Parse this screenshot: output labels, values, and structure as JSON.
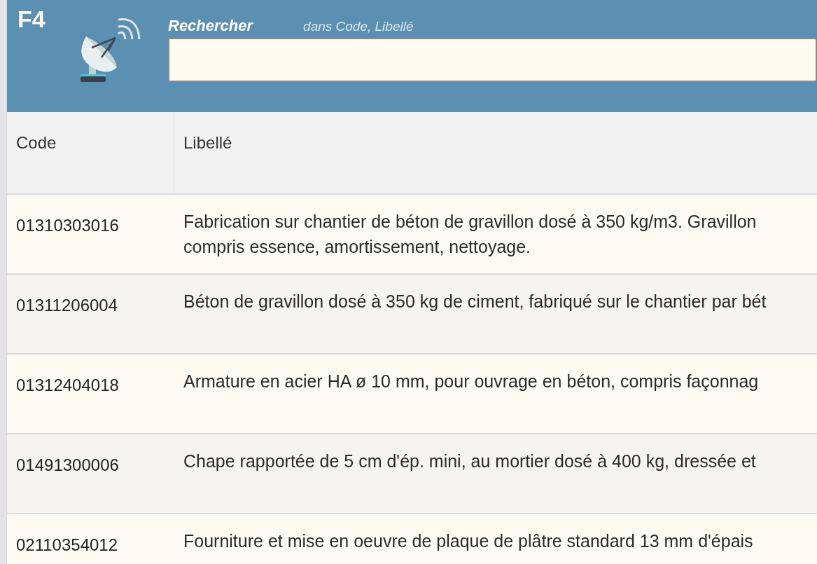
{
  "header": {
    "shortcut": "F4",
    "search_label": "Rechercher",
    "search_scope": "dans Code, Libellé"
  },
  "table": {
    "columns": [
      "Code",
      "Libellé"
    ],
    "rows": [
      {
        "code": "01310303016",
        "label_lines": [
          "Fabrication sur chantier de béton de gravillon dosé à 350 kg/m3. Gravillon",
          "compris essence, amortissement, nettoyage."
        ]
      },
      {
        "code": "01311206004",
        "label_lines": [
          "Béton de gravillon dosé à 350 kg de ciment, fabriqué sur le chantier par bét"
        ]
      },
      {
        "code": "01312404018",
        "label_lines": [
          "Armature en acier HA ø 10 mm, pour ouvrage en béton, compris façonnag"
        ]
      },
      {
        "code": "01491300006",
        "label_lines": [
          "Chape rapportée de 5 cm d'ép. mini, au mortier dosé à 400 kg, dressée et"
        ]
      },
      {
        "code": "02110354012",
        "label_lines": [
          "Fourniture et mise en oeuvre de plaque de plâtre standard 13 mm d'épais"
        ]
      }
    ]
  }
}
